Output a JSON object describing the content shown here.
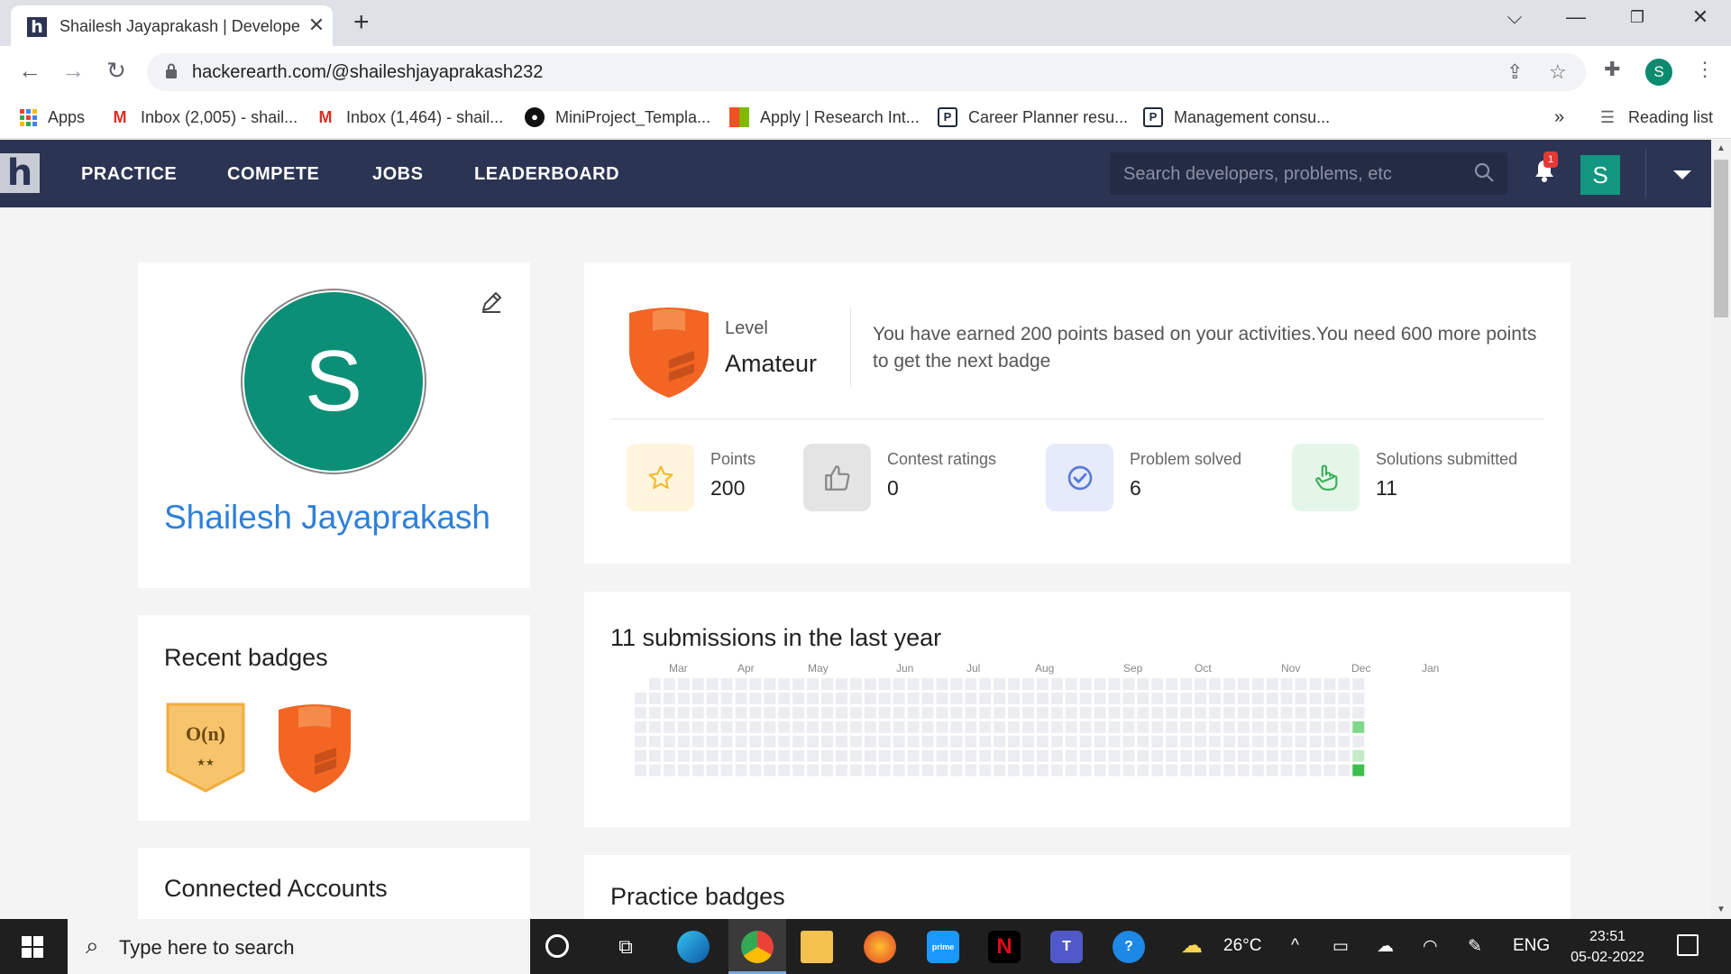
{
  "browser": {
    "tab_title": "Shailesh Jayaprakash | Developer",
    "favicon": "h",
    "url": "hackerearth.com/@shaileshjayaprakash232",
    "profile_initial": "S",
    "bookmarks": [
      {
        "label": "Apps",
        "icon": "apps-grid-icon"
      },
      {
        "label": "Inbox (2,005) - shail...",
        "icon": "gmail-icon"
      },
      {
        "label": "Inbox (1,464) - shail...",
        "icon": "gmail-icon"
      },
      {
        "label": "MiniProject_Templa...",
        "icon": "github-icon"
      },
      {
        "label": "Apply | Research Int...",
        "icon": "microsoft-icon"
      },
      {
        "label": "Career Planner resu...",
        "icon": "p-icon"
      },
      {
        "label": "Management consu...",
        "icon": "p-icon"
      }
    ],
    "bookmarks_overflow": "»",
    "reading_list": "Reading list"
  },
  "site": {
    "logo": "h",
    "nav": [
      "PRACTICE",
      "COMPETE",
      "JOBS",
      "LEADERBOARD"
    ],
    "search_placeholder": "Search developers, problems, etc",
    "notification_count": "1",
    "user_initial": "S"
  },
  "profile": {
    "initial": "S",
    "name": "Shailesh Jayaprakash"
  },
  "recent_badges": {
    "title": "Recent badges",
    "badge1_text": "O(n)",
    "badge1_stars": "★★"
  },
  "connected_accounts": {
    "title": "Connected Accounts"
  },
  "level": {
    "label": "Level",
    "value": "Amateur",
    "message": "You have earned 200 points based on your activities.You need 600 more points to get the next badge"
  },
  "stats": [
    {
      "label": "Points",
      "value": "200",
      "icon": "star-icon",
      "bg": "#fff5dc",
      "color": "#f5b82e"
    },
    {
      "label": "Contest ratings",
      "value": "0",
      "icon": "thumbs-up-icon",
      "bg": "#e4e4e4",
      "color": "#888888"
    },
    {
      "label": "Problem solved",
      "value": "6",
      "icon": "check-circle-icon",
      "bg": "#e6ebfb",
      "color": "#5a7ad8"
    },
    {
      "label": "Solutions submitted",
      "value": "11",
      "icon": "pointer-hand-icon",
      "bg": "#e4f6e8",
      "color": "#3cb05a"
    }
  ],
  "activity": {
    "title": "11 submissions in the last year",
    "months": [
      "Mar",
      "Apr",
      "May",
      "Jun",
      "Jul",
      "Aug",
      "Sep",
      "Oct",
      "Nov",
      "Dec",
      "Jan"
    ],
    "weeks": 51,
    "active_cells": [
      {
        "week": 50,
        "day": 3,
        "level": 2
      },
      {
        "week": 50,
        "day": 5,
        "level": 1
      },
      {
        "week": 50,
        "day": 6,
        "level": 3
      }
    ],
    "colors": {
      "empty": "#ebedf0",
      "level1": "#c6ebc9",
      "level2": "#7fd88a",
      "level3": "#3cc04b"
    }
  },
  "practice_badges": {
    "title": "Practice badges"
  },
  "taskbar": {
    "search_placeholder": "Type here to search",
    "weather": "26°C",
    "language": "ENG",
    "time": "23:51",
    "date": "05-02-2022"
  }
}
